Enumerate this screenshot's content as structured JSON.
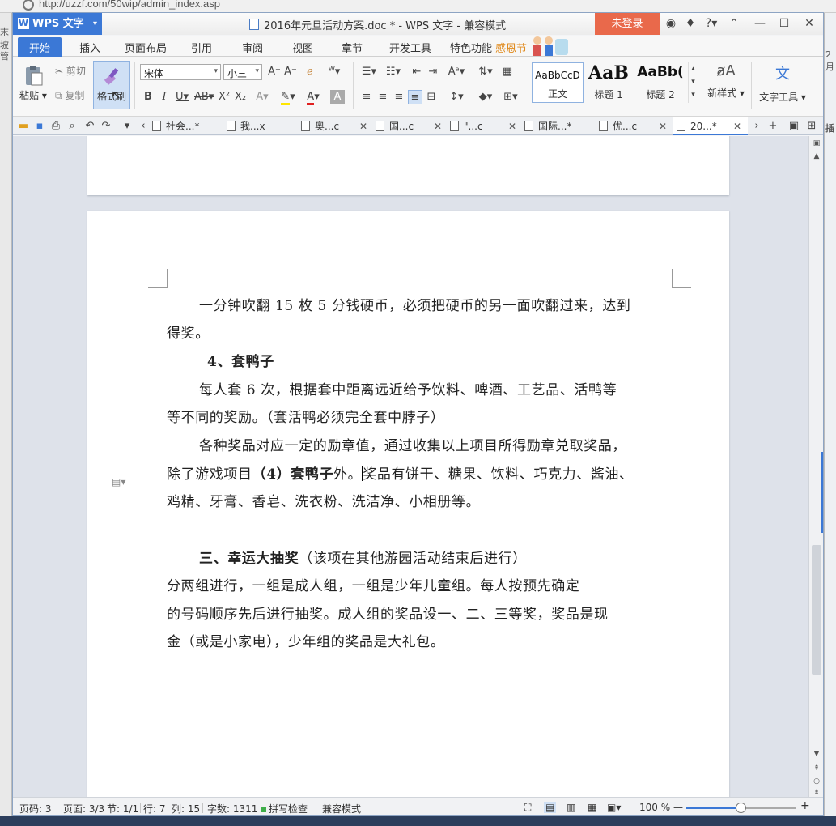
{
  "browser": {
    "url": "http://uzzf.com/50wip/admin_index.asp",
    "left_edge": [
      "末坡",
      "管"
    ],
    "right_edge": [
      "2月",
      "插"
    ]
  },
  "titlebar": {
    "app_button": "WPS 文字",
    "doc_title": "2016年元旦活动方案.doc * - WPS 文字 - 兼容模式",
    "login": "未登录"
  },
  "menu": {
    "tabs": [
      "开始",
      "插入",
      "页面布局",
      "引用",
      "审阅",
      "视图",
      "章节",
      "开发工具",
      "特色功能"
    ],
    "festive": "感恩节"
  },
  "ribbon": {
    "paste": "粘贴",
    "cut": "剪切",
    "copy": "复制",
    "format_painter": "格式刷",
    "font_name": "宋体",
    "font_size": "小三",
    "styles": [
      {
        "sample": "AaBbCcD",
        "label": "正文"
      },
      {
        "sample": "AaB",
        "label": "标题 1"
      },
      {
        "sample": "AaBb(",
        "label": "标题 2"
      }
    ],
    "new_style": "新样式",
    "text_tools": "文字工具"
  },
  "doc_tabs": [
    "社会...*",
    "我...x",
    "奥...c",
    "国...c",
    "\"...c",
    "国际...*",
    "优...c",
    "20...*"
  ],
  "document": {
    "lines": [
      "一分钟吹翻 15 枚 5 分钱硬币，必须把硬币的另一面吹翻过来，达到",
      "得奖。",
      "4、套鸭子",
      "每人套 6 次，根据套中距离远近给予饮料、啤酒、工艺品、活鸭等",
      "等不同的奖励。（套活鸭必须完全套中脖子）",
      "各种奖品对应一定的励章值，通过收集以上项目所得励章兑取奖品，",
      "除了游戏项目",
      "（4）套鸭子",
      "外。",
      "奖品有饼干、糖果、饮料、巧克力、酱油、",
      "鸡精、牙膏、香皂、洗衣粉、洗洁净、小相册等。",
      "三、幸运大抽奖",
      "（该项在其他游园活动结束后进行）",
      "分两组进行，一组是成人组，一组是少年儿童组。每人按预先确定",
      "的号码顺序先后进行抽奖。成人组的奖品设一、二、三等奖，奖品是现",
      "金（或是小家电），少年组的奖品是大礼包。"
    ]
  },
  "status": {
    "page_num": "页码: 3",
    "pages": "页面: 3/3",
    "section": "节: 1/1",
    "row": "行: 7",
    "col": "列: 15",
    "words": "字数: 1311",
    "spell": "拼写检查",
    "compat": "兼容模式",
    "zoom": "100 %",
    "zoom_fraction": 0.5
  }
}
